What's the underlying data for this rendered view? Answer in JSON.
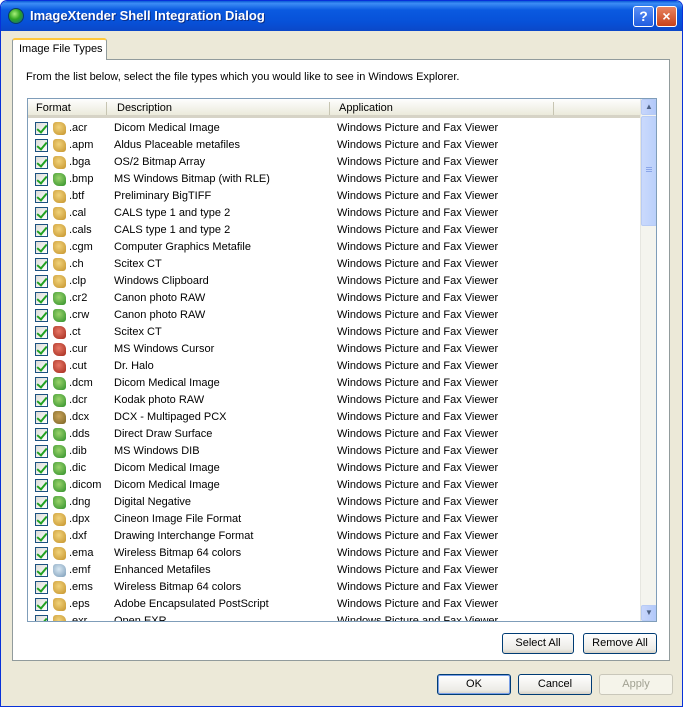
{
  "window": {
    "title": "ImageXtender Shell Integration Dialog",
    "help_label": "?",
    "close_label": "×"
  },
  "tab": {
    "label": "Image File Types"
  },
  "instruction": "From the list below, select the file types which you would like to see in Windows Explorer.",
  "columns": {
    "format": "Format",
    "description": "Description",
    "application": "Application"
  },
  "rows": [
    {
      "ext": ".acr",
      "desc": "Dicom Medical Image",
      "app": "Windows Picture and Fax Viewer",
      "icon": "t0"
    },
    {
      "ext": ".apm",
      "desc": "Aldus Placeable metafiles",
      "app": "Windows Picture and Fax Viewer",
      "icon": "t0"
    },
    {
      "ext": ".bga",
      "desc": "OS/2 Bitmap Array",
      "app": "Windows Picture and Fax Viewer",
      "icon": "t0"
    },
    {
      "ext": ".bmp",
      "desc": "MS Windows Bitmap (with RLE)",
      "app": "Windows Picture and Fax Viewer",
      "icon": "t1"
    },
    {
      "ext": ".btf",
      "desc": "Preliminary BigTIFF",
      "app": "Windows Picture and Fax Viewer",
      "icon": "t0"
    },
    {
      "ext": ".cal",
      "desc": "CALS type 1 and type 2",
      "app": "Windows Picture and Fax Viewer",
      "icon": "t0"
    },
    {
      "ext": ".cals",
      "desc": "CALS type 1 and type 2",
      "app": "Windows Picture and Fax Viewer",
      "icon": "t0"
    },
    {
      "ext": ".cgm",
      "desc": "Computer Graphics Metafile",
      "app": "Windows Picture and Fax Viewer",
      "icon": "t0"
    },
    {
      "ext": ".ch",
      "desc": "Scitex CT",
      "app": "Windows Picture and Fax Viewer",
      "icon": "t0"
    },
    {
      "ext": ".clp",
      "desc": "Windows Clipboard",
      "app": "Windows Picture and Fax Viewer",
      "icon": "t0"
    },
    {
      "ext": ".cr2",
      "desc": "Canon photo RAW",
      "app": "Windows Picture and Fax Viewer",
      "icon": "t1"
    },
    {
      "ext": ".crw",
      "desc": "Canon photo RAW",
      "app": "Windows Picture and Fax Viewer",
      "icon": "t1"
    },
    {
      "ext": ".ct",
      "desc": "Scitex CT",
      "app": "Windows Picture and Fax Viewer",
      "icon": "t2"
    },
    {
      "ext": ".cur",
      "desc": "MS Windows Cursor",
      "app": "Windows Picture and Fax Viewer",
      "icon": "t2"
    },
    {
      "ext": ".cut",
      "desc": "Dr. Halo",
      "app": "Windows Picture and Fax Viewer",
      "icon": "t2"
    },
    {
      "ext": ".dcm",
      "desc": "Dicom Medical Image",
      "app": "Windows Picture and Fax Viewer",
      "icon": "t1"
    },
    {
      "ext": ".dcr",
      "desc": "Kodak photo RAW",
      "app": "Windows Picture and Fax Viewer",
      "icon": "t1"
    },
    {
      "ext": ".dcx",
      "desc": "DCX - Multipaged PCX",
      "app": "Windows Picture and Fax Viewer",
      "icon": "t3"
    },
    {
      "ext": ".dds",
      "desc": "Direct Draw Surface",
      "app": "Windows Picture and Fax Viewer",
      "icon": "t1"
    },
    {
      "ext": ".dib",
      "desc": "MS Windows DIB",
      "app": "Windows Picture and Fax Viewer",
      "icon": "t1"
    },
    {
      "ext": ".dic",
      "desc": "Dicom Medical Image",
      "app": "Windows Picture and Fax Viewer",
      "icon": "t1"
    },
    {
      "ext": ".dicom",
      "desc": "Dicom Medical Image",
      "app": "Windows Picture and Fax Viewer",
      "icon": "t1"
    },
    {
      "ext": ".dng",
      "desc": "Digital Negative",
      "app": "Windows Picture and Fax Viewer",
      "icon": "t1"
    },
    {
      "ext": ".dpx",
      "desc": "Cineon Image File Format",
      "app": "Windows Picture and Fax Viewer",
      "icon": "t0"
    },
    {
      "ext": ".dxf",
      "desc": "Drawing Interchange Format",
      "app": "Windows Picture and Fax Viewer",
      "icon": "t0"
    },
    {
      "ext": ".ema",
      "desc": "Wireless Bitmap 64 colors",
      "app": "Windows Picture and Fax Viewer",
      "icon": "t0"
    },
    {
      "ext": ".emf",
      "desc": "Enhanced Metafiles",
      "app": "Windows Picture and Fax Viewer",
      "icon": "t4"
    },
    {
      "ext": ".ems",
      "desc": "Wireless Bitmap 64 colors",
      "app": "Windows Picture and Fax Viewer",
      "icon": "t0"
    },
    {
      "ext": ".eps",
      "desc": "Adobe Encapsulated PostScript",
      "app": "Windows Picture and Fax Viewer",
      "icon": "t0"
    },
    {
      "ext": ".exr",
      "desc": "Open EXR",
      "app": "Windows Picture and Fax Viewer",
      "icon": "t0"
    }
  ],
  "buttons": {
    "select_all": "Select All",
    "remove_all": "Remove All",
    "ok": "OK",
    "cancel": "Cancel",
    "apply": "Apply"
  },
  "colors": {
    "titlebar": "#0a5ae0",
    "face": "#ece9d8",
    "check": "#21a121"
  }
}
